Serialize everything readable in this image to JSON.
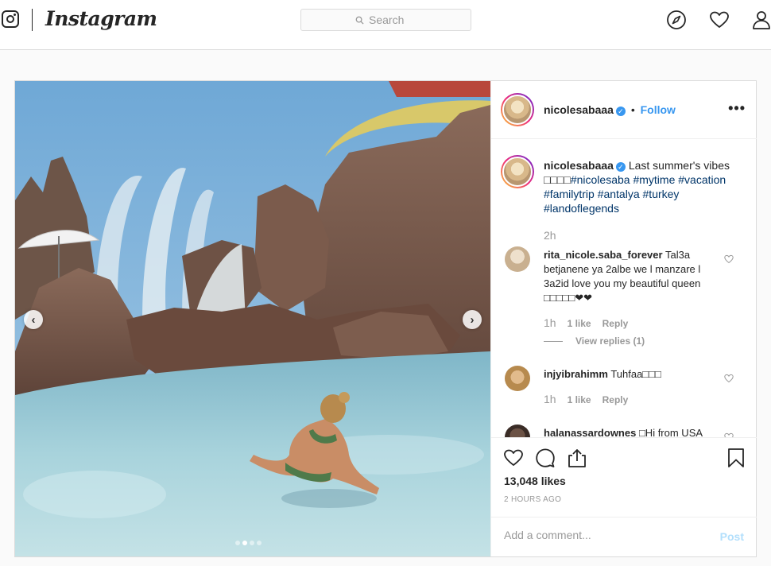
{
  "nav": {
    "logo": "Instagram",
    "search_placeholder": "Search",
    "icons": [
      "instagram-glyph-icon",
      "compass-icon",
      "heart-icon",
      "profile-icon"
    ]
  },
  "post": {
    "username": "nicolesabaaa",
    "separator": "•",
    "follow_label": "Follow",
    "more_label": "•••",
    "caption": {
      "username": "nicolesabaaa",
      "text": "Last summer's vibes",
      "emoji": "□□□□",
      "hashtags": [
        "#nicolesaba",
        "#mytime",
        "#vacation",
        "#familytrip",
        "#antalya",
        "#turkey",
        "#landoflegends"
      ],
      "time": "2h"
    },
    "comments": [
      {
        "username": "rita_nicole.saba_forever",
        "text": "Tal3a betjanene ya 2albe we l manzare l 3a2id love you my beautiful queen □□□□□❤❤",
        "time": "1h",
        "likes": "1 like",
        "reply": "Reply",
        "view_replies": "View replies (1)"
      },
      {
        "username": "injyibrahimm",
        "text": "Tuhfaa□□□",
        "time": "1h",
        "likes": "1 like",
        "reply": "Reply"
      },
      {
        "username": "halanassardownes",
        "text": "□Hi from USA"
      }
    ],
    "likes": "13,048 likes",
    "posted": "2 HOURS AGO",
    "comment_placeholder": "Add a comment...",
    "post_label": "Post",
    "carousel": {
      "slides": 4,
      "active": 1
    }
  },
  "colors": {
    "link": "#3897f0",
    "hashtag": "#003569",
    "muted": "#999999",
    "border": "#dbdbdb"
  }
}
